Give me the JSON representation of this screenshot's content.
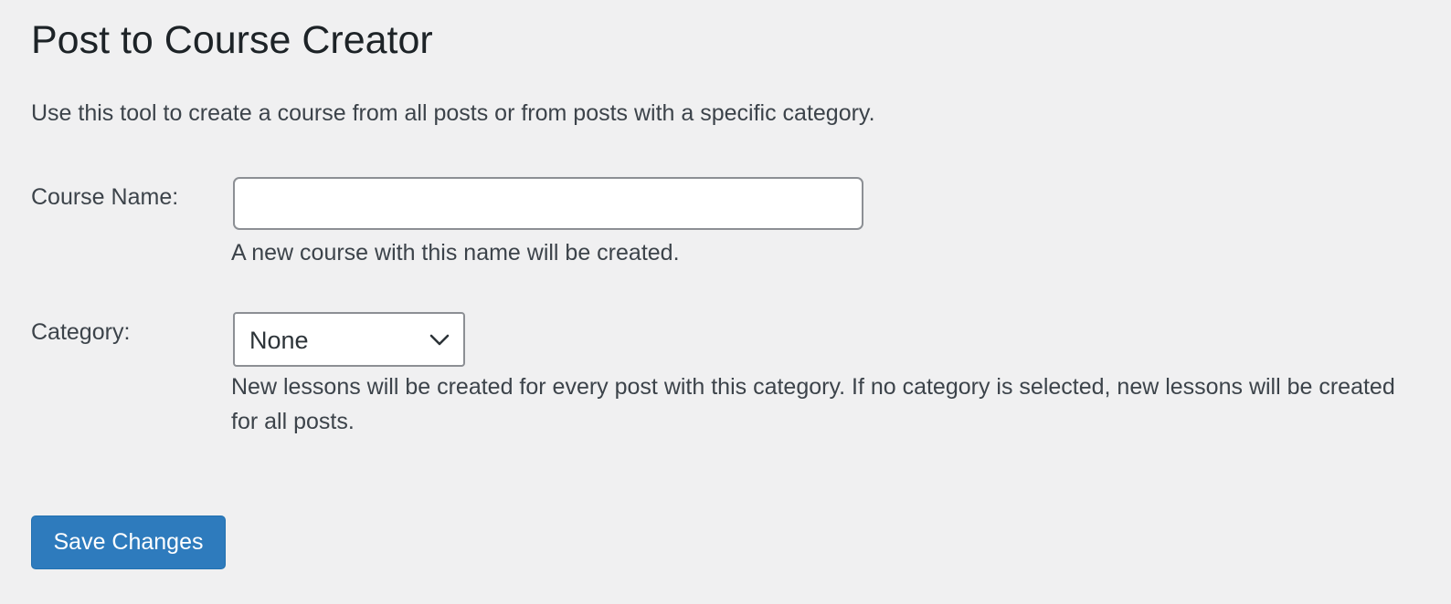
{
  "page": {
    "title": "Post to Course Creator",
    "intro": "Use this tool to create a course from all posts or from posts with a specific category."
  },
  "form": {
    "course_name": {
      "label": "Course Name:",
      "value": "",
      "placeholder": "",
      "description": "A new course with this name will be created."
    },
    "category": {
      "label": "Category:",
      "selected": "None",
      "description": "New lessons will be created for every post with this category. If no category is selected, new lessons will be created for all posts."
    }
  },
  "actions": {
    "save_label": "Save Changes"
  },
  "icons": {
    "select_arrow": "chevron-down-icon"
  },
  "colors": {
    "background": "#f0f0f1",
    "primary_button": "#2e7bbd",
    "text": "#3c434a",
    "heading": "#1d2327"
  }
}
